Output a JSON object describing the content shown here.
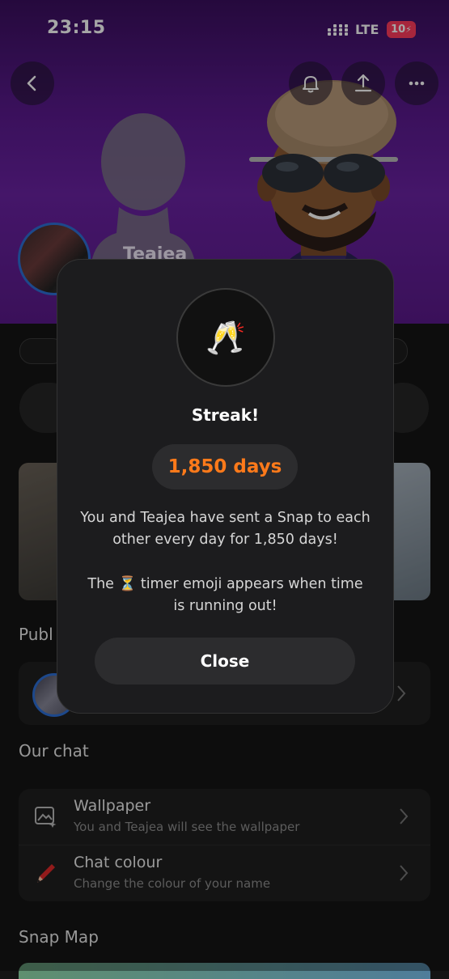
{
  "status_bar": {
    "time": "23:15",
    "network": "LTE",
    "battery": "10"
  },
  "profile": {
    "name": "Teajea"
  },
  "sections": {
    "public": "Publ",
    "our_chat": "Our chat",
    "snap_map": "Snap Map"
  },
  "chat_settings": [
    {
      "title": "Wallpaper",
      "subtitle": "You and Teajea will see the wallpaper",
      "icon": "wallpaper-icon"
    },
    {
      "title": "Chat colour",
      "subtitle": "Change the colour of your name",
      "icon": "crayon-icon"
    }
  ],
  "modal": {
    "emoji": "🥂",
    "title": "Streak!",
    "days": "1,850 days",
    "text1_line1": "You and Teajea have sent a Snap to each",
    "text1_line2": "other every day for 1,850 days!",
    "text2_line1": "The ⏳ timer emoji appears when time",
    "text2_line2": "is running out!",
    "close": "Close"
  },
  "colors": {
    "accent_orange": "#ff7a1a",
    "header_purple": "#5a1a8e",
    "ring_blue": "#2d6fd6"
  }
}
